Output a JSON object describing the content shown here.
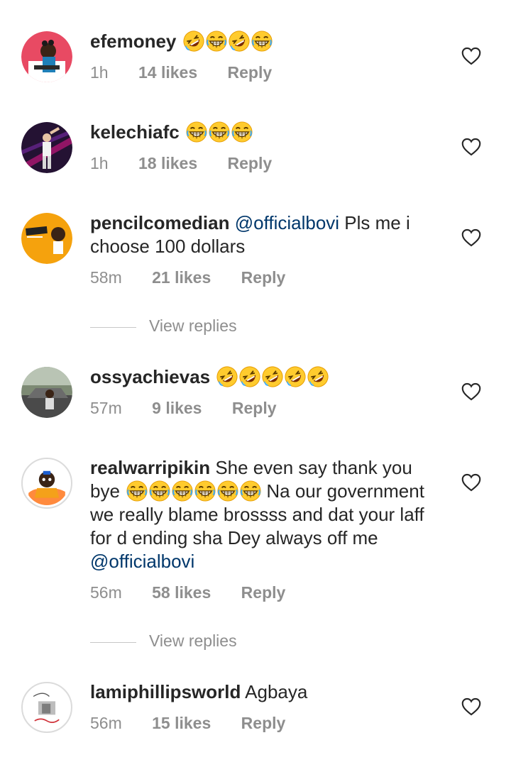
{
  "comments": [
    {
      "username": "efemoney",
      "text": "",
      "emojis": [
        "rofl",
        "grin",
        "rofl",
        "grin"
      ],
      "time": "1h",
      "likes": "14 likes",
      "reply": "Reply",
      "avatar": "illustrated-man-avatar"
    },
    {
      "username": "kelechiafc",
      "text": "",
      "emojis": [
        "grin",
        "grin",
        "grin"
      ],
      "time": "1h",
      "likes": "18 likes",
      "reply": "Reply",
      "avatar": "stage-performer-avatar"
    },
    {
      "username": "pencilcomedian",
      "mention": "@officialbovi",
      "text": "Pls me i choose 100 dollars",
      "time": "58m",
      "likes": "21 likes",
      "reply": "Reply",
      "avatar": "banabas-avatar",
      "view_replies": "View replies"
    },
    {
      "username": "ossyachievas",
      "text": "",
      "emojis": [
        "rofl",
        "rofl",
        "rofl",
        "rofl",
        "rofl"
      ],
      "time": "57m",
      "likes": "9 likes",
      "reply": "Reply",
      "avatar": "car-photo-avatar"
    },
    {
      "username": "realwarripikin",
      "text_a": "She even say thank you bye",
      "emojis": [
        "grin",
        "grin",
        "grin",
        "grin",
        "grin",
        "grin"
      ],
      "text_b": "Na our government we really blame brossss and dat your laff for d ending sha Dey always off me",
      "mention": "@officialbovi",
      "time": "56m",
      "likes": "58 likes",
      "reply": "Reply",
      "avatar": "cartoon-avatar",
      "view_replies": "View replies"
    },
    {
      "username": "lamiphillipsworld",
      "text": "Agbaya",
      "time": "56m",
      "likes": "15 likes",
      "reply": "Reply",
      "avatar": "signature-logo-avatar"
    }
  ],
  "colors": {
    "mention": "#00376b",
    "meta": "#8e8e8e",
    "text": "#262626"
  }
}
